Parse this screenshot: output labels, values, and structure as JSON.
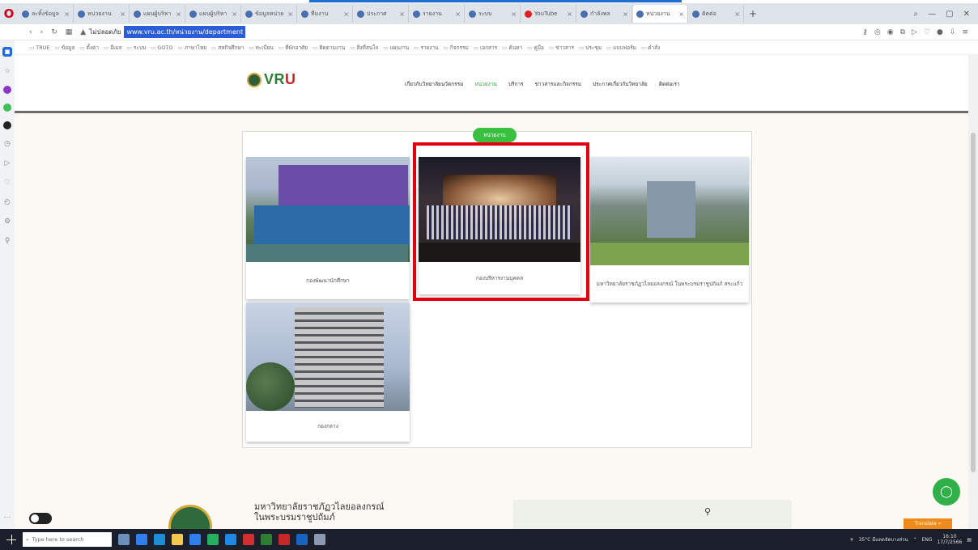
{
  "browser": {
    "tabs": [
      {
        "label": "ละทิ้งข้อมูล"
      },
      {
        "label": "หน่วยงาน"
      },
      {
        "label": "แผนผู้บริหา"
      },
      {
        "label": "แผนผู้บริหา"
      },
      {
        "label": "ข้อมูลหน่วย"
      },
      {
        "label": "ทีมงาน"
      },
      {
        "label": "ประกาศ"
      },
      {
        "label": "รายงาน"
      },
      {
        "label": "ระบบ"
      },
      {
        "label": "YouTube"
      },
      {
        "label": "กำลังพล"
      },
      {
        "label": "หน่วยงาน"
      },
      {
        "label": "ติดต่อ"
      }
    ],
    "security_label": "ไม่ปลอดภัย",
    "url": "www.vru.ac.th/หน่วยงาน/department",
    "bookmarks": [
      "TRUE",
      "ข้อมูล",
      "ตั้งค่า",
      "อีเมล",
      "ระบบ",
      "GOTO",
      "ภาษาไทย",
      "สหกิจศึกษา",
      "ทะเบียน",
      "ที่พักอาศัย",
      "ติดตามงาน",
      "สิ่งที่สนใจ",
      "แผนงาน",
      "รายงาน",
      "กิจกรรม",
      "เอกสาร",
      "ค้นหา",
      "คู่มือ",
      "ข่าวสาร",
      "ประชุม",
      "แบบฟอร์ม",
      "คำสั่ง"
    ]
  },
  "site": {
    "logo_text_main": "VR",
    "logo_text_accent": "U",
    "nav": [
      {
        "label": "เกี่ยวกับวิทยาลัยนวัตกรรม",
        "active": false
      },
      {
        "label": "หน่วยงาน",
        "active": true
      },
      {
        "label": "บริการ",
        "active": false
      },
      {
        "label": "ข่าวสารและกิจกรรม",
        "active": false
      },
      {
        "label": "ประกาศเกี่ยวกับวิทยาลัย",
        "active": false
      },
      {
        "label": "ติดต่อเรา",
        "active": false
      }
    ],
    "section_badge": "หน่วยงาน",
    "cards": [
      {
        "caption": "กองพัฒนานักศึกษา"
      },
      {
        "caption": "กองบริหารงานบุคคล"
      },
      {
        "caption": "มหาวิทยาลัยราชภัฏวไลยอลงกรณ์ ในพระบรมราชูปถัมภ์ สระแก้ว"
      },
      {
        "caption": "กองกลาง"
      }
    ],
    "footer_title_line1": "มหาวิทยาลัยราชภัฏวไลยอลงกรณ์",
    "footer_title_line2": "ในพระบรมราชูปถัมภ์",
    "translate_label": "Translate »"
  },
  "taskbar": {
    "search_placeholder": "Type here to search",
    "weather": "35°C  มีแดดจัดบางส่วน",
    "lang": "ENG",
    "time": "16:10",
    "date": "17/7/2566"
  },
  "colors": {
    "accent_green": "#3ac03f",
    "highlight_red": "#e2000f",
    "url_highlight": "#2c5dd8"
  }
}
